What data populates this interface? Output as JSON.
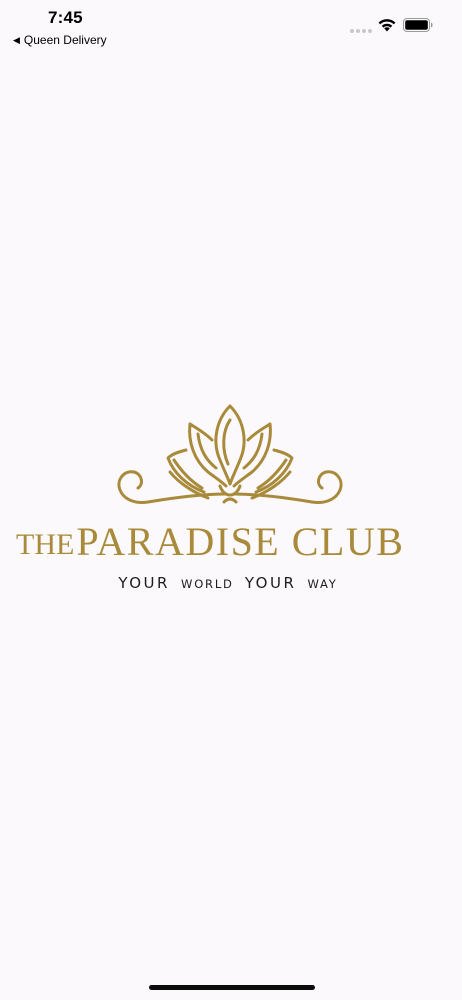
{
  "status_bar": {
    "time": "7:45",
    "back_app": "Queen Delivery"
  },
  "logo": {
    "title_prefix": "THE",
    "title_main": "PARADISE CLUB",
    "tagline_part1": "YOUR",
    "tagline_part2": "WORLD",
    "tagline_part3": "YOUR",
    "tagline_part4": "WAY"
  },
  "colors": {
    "brand_gold": "#a88a3a",
    "background": "#fbf9fb",
    "tagline": "#1d1d1d"
  }
}
